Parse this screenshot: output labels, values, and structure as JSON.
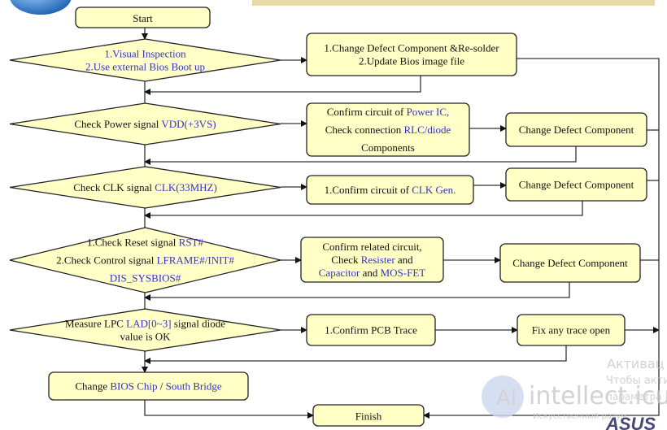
{
  "colors": {
    "node_fill": "#ffffc6",
    "text": "#111111",
    "highlight": "#3333cc",
    "header_band": "#e8d9a8"
  },
  "watermark": {
    "line1": "Активац",
    "line2": "Чтобы акти",
    "line3": "параметра",
    "brand": "intellect.icu",
    "brand_sub": "Искусственный разум"
  },
  "nodes": {
    "start": {
      "shape": "box",
      "lines": [
        [
          {
            "t": "Start"
          }
        ]
      ]
    },
    "d1": {
      "shape": "diamond",
      "lines": [
        [
          {
            "t": "1.Visual Inspection",
            "hl": true
          }
        ],
        [
          {
            "t": "2.Use external Bios Boot up",
            "hl": true
          }
        ]
      ]
    },
    "b1": {
      "shape": "box",
      "lines": [
        [
          {
            "t": "1.Change Defect Component &Re-solder"
          }
        ],
        [
          {
            "t": "2.Update Bios image file"
          }
        ]
      ]
    },
    "d2": {
      "shape": "diamond",
      "lines": [
        [
          {
            "t": "Check Power signal "
          },
          {
            "t": "VDD(+3VS)",
            "hl": true
          }
        ]
      ]
    },
    "b2": {
      "shape": "box",
      "lines": [
        [
          {
            "t": "Confirm circuit of "
          },
          {
            "t": "Power IC,",
            "hl": true
          }
        ],
        [
          {
            "t": "Check connection "
          },
          {
            "t": "RLC/diode",
            "hl": true
          }
        ],
        [
          {
            "t": "Components"
          }
        ]
      ]
    },
    "b3": {
      "shape": "box",
      "lines": [
        [
          {
            "t": "Change Defect Component"
          }
        ]
      ]
    },
    "d3": {
      "shape": "diamond",
      "lines": [
        [
          {
            "t": "Check CLK signal "
          },
          {
            "t": "CLK(33MHZ)",
            "hl": true
          }
        ]
      ]
    },
    "b4": {
      "shape": "box",
      "lines": [
        [
          {
            "t": "1.Confirm circuit of "
          },
          {
            "t": "CLK Gen.",
            "hl": true
          }
        ]
      ]
    },
    "b5": {
      "shape": "box",
      "lines": [
        [
          {
            "t": "Change Defect Component"
          }
        ]
      ]
    },
    "d4": {
      "shape": "diamond",
      "lines": [
        [
          {
            "t": "1.Check Reset signal "
          },
          {
            "t": "RST#",
            "hl": true
          }
        ],
        [
          {
            "t": "2.Check Control signal "
          },
          {
            "t": "LFRAME#/INIT#",
            "hl": true
          }
        ],
        [
          {
            "t": "DIS_SYSBIOS#",
            "hl": true
          }
        ]
      ]
    },
    "b6": {
      "shape": "box",
      "lines": [
        [
          {
            "t": "Confirm related circuit,"
          }
        ],
        [
          {
            "t": "Check "
          },
          {
            "t": "Resister",
            "hl": true
          },
          {
            "t": " and"
          }
        ],
        [
          {
            "t": "Capacitor",
            "hl": true
          },
          {
            "t": " and "
          },
          {
            "t": "MOS-FET",
            "hl": true
          }
        ]
      ]
    },
    "b7": {
      "shape": "box",
      "lines": [
        [
          {
            "t": "Change Defect Component"
          }
        ]
      ]
    },
    "d5": {
      "shape": "diamond",
      "lines": [
        [
          {
            "t": "Measure LPC "
          },
          {
            "t": "LAD[0~3]",
            "hl": true
          },
          {
            "t": " signal diode"
          }
        ],
        [
          {
            "t": "value  is OK"
          }
        ]
      ]
    },
    "b8": {
      "shape": "box",
      "lines": [
        [
          {
            "t": "1.Confirm PCB Trace"
          }
        ]
      ]
    },
    "b9": {
      "shape": "box",
      "lines": [
        [
          {
            "t": "Fix any trace open"
          }
        ]
      ]
    },
    "b10": {
      "shape": "box",
      "lines": [
        [
          {
            "t": "Change "
          },
          {
            "t": "BIOS Chip",
            "hl": true
          },
          {
            "t": " / "
          },
          {
            "t": "South Bridge",
            "hl": true
          }
        ]
      ]
    },
    "finish": {
      "shape": "box",
      "lines": [
        [
          {
            "t": "Finish"
          }
        ]
      ]
    }
  }
}
